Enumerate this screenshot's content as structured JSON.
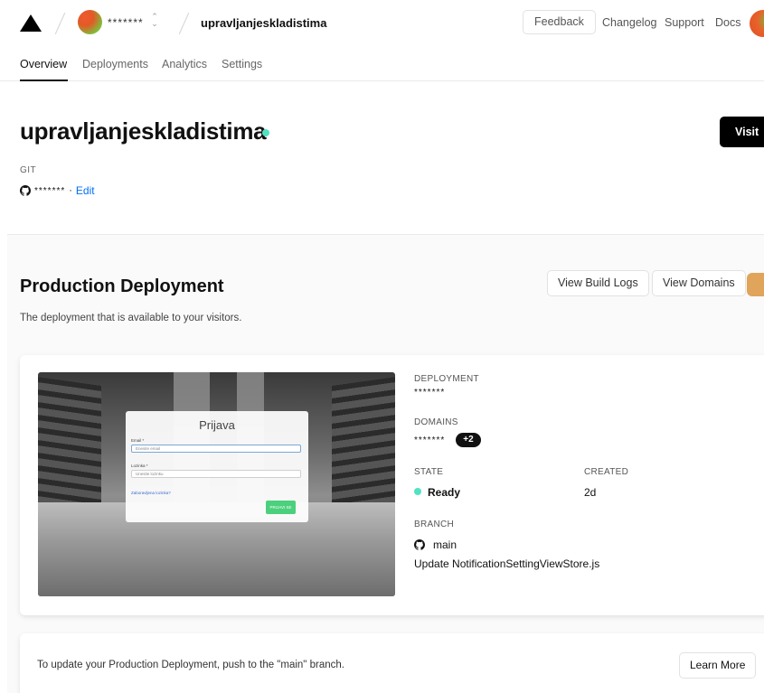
{
  "topbar": {
    "team_name": "*******",
    "project_name": "upravljanjeskladistima",
    "feedback_label": "Feedback",
    "links": [
      "Changelog",
      "Support",
      "Docs"
    ]
  },
  "tabs": [
    "Overview",
    "Deployments",
    "Analytics",
    "Settings"
  ],
  "project": {
    "title": "upravljanjeskladistima",
    "visit_label": "Visit",
    "git_label": "GIT",
    "git_repo": "*******",
    "git_sep": "·",
    "edit_label": "Edit"
  },
  "production": {
    "title": "Production Deployment",
    "subtitle": "The deployment that is available to your visitors.",
    "view_build_logs": "View Build Logs",
    "view_domains": "View Domains"
  },
  "preview": {
    "login_title": "Prijava",
    "email_label": "Email *",
    "email_placeholder": "Enesite email",
    "password_label": "Lozinka *",
    "password_placeholder": "Unesite lozinku",
    "forgot_link": "Zaboravljena lozinka?",
    "login_button": "PRIJAVI SE"
  },
  "deployment": {
    "deployment_label": "DEPLOYMENT",
    "deployment_value": "*******",
    "domains_label": "DOMAINS",
    "domains_value": "*******",
    "domains_extra": "+2",
    "state_label": "STATE",
    "state_value": "Ready",
    "created_label": "CREATED",
    "created_value": "2d",
    "branch_label": "BRANCH",
    "branch_value": "main",
    "commit_message": "Update NotificationSettingViewStore.js"
  },
  "info": {
    "text": "To update your Production Deployment, push to the \"main\" branch.",
    "learn_more": "Learn More"
  },
  "colors": {
    "accent_ready": "#50e3c2",
    "link_blue": "#0070f3"
  }
}
